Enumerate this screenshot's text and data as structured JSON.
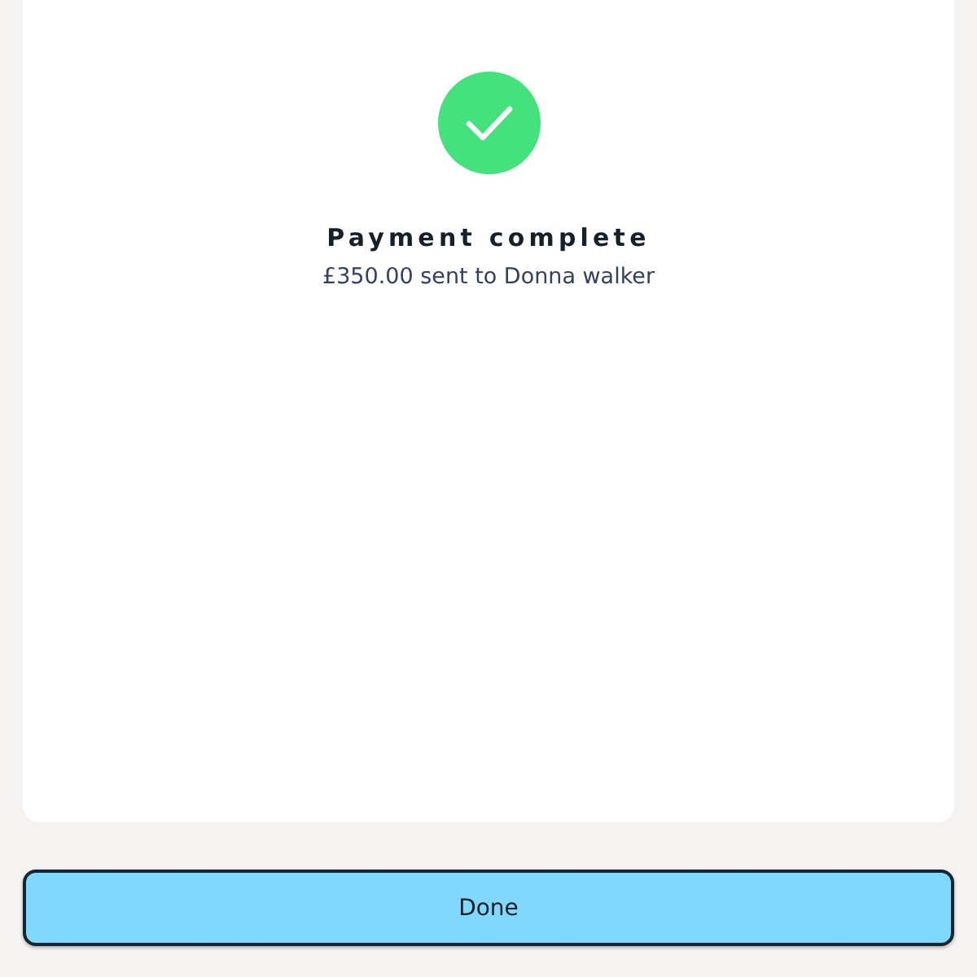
{
  "title": "Payment complete",
  "message": "£350.00 sent to Donna walker",
  "button": {
    "label": "Done"
  }
}
